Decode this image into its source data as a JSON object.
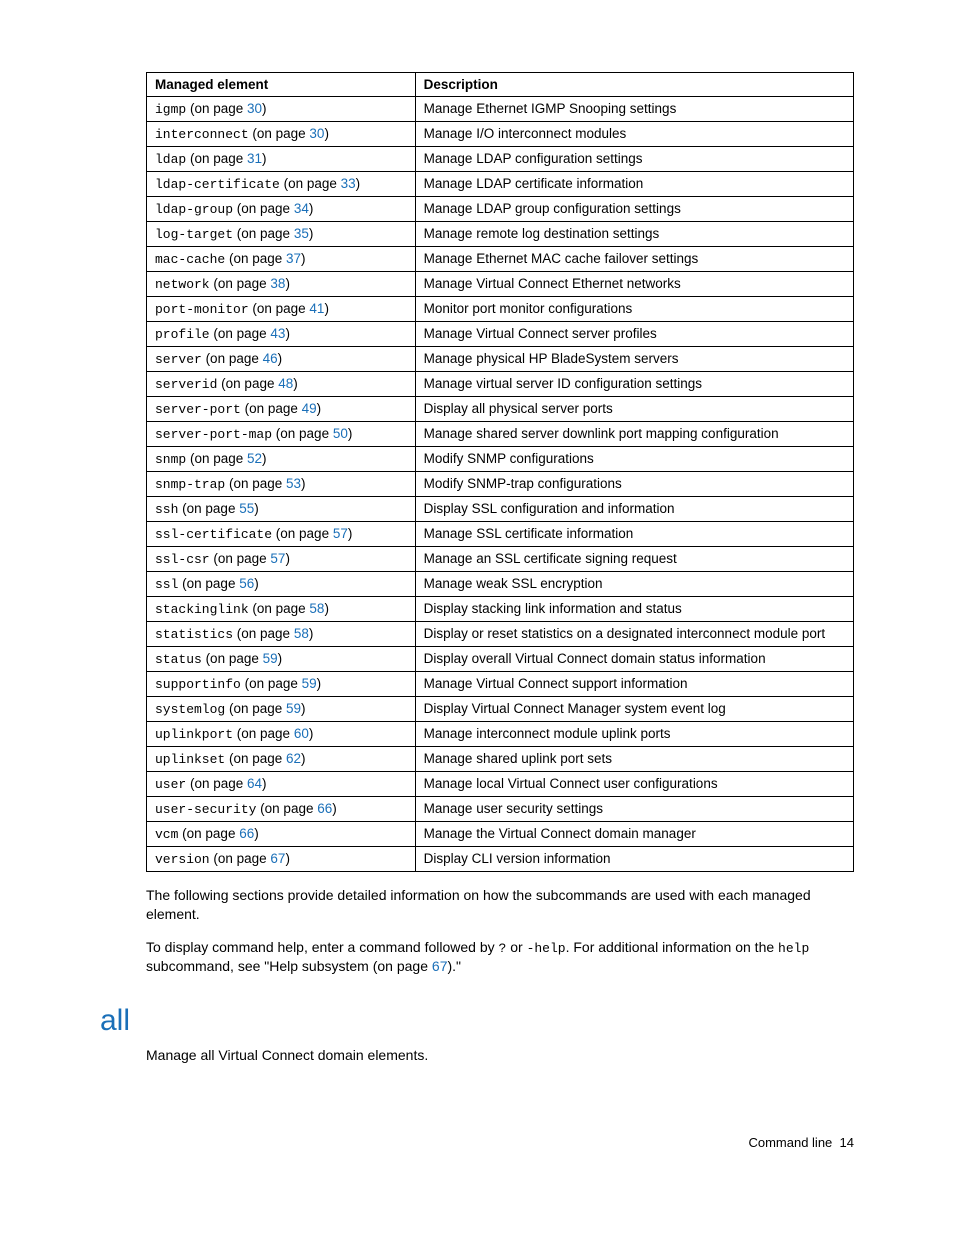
{
  "table": {
    "headers": {
      "element": "Managed element",
      "description": "Description"
    },
    "rows": [
      {
        "cmd": "igmp",
        "page": "30",
        "desc": "Manage Ethernet IGMP Snooping settings"
      },
      {
        "cmd": "interconnect",
        "page": "30",
        "desc": "Manage I/O interconnect modules"
      },
      {
        "cmd": "ldap",
        "page": "31",
        "desc": "Manage LDAP configuration settings"
      },
      {
        "cmd": "ldap-certificate",
        "page": "33",
        "desc": "Manage LDAP certificate information"
      },
      {
        "cmd": "ldap-group",
        "page": "34",
        "desc": "Manage LDAP group configuration settings"
      },
      {
        "cmd": "log-target",
        "page": "35",
        "desc": "Manage remote log destination settings"
      },
      {
        "cmd": "mac-cache",
        "page": "37",
        "desc": "Manage Ethernet MAC cache failover settings"
      },
      {
        "cmd": "network",
        "page": "38",
        "desc": "Manage Virtual Connect Ethernet networks"
      },
      {
        "cmd": "port-monitor",
        "page": "41",
        "desc": "Monitor port monitor configurations"
      },
      {
        "cmd": "profile",
        "page": "43",
        "desc": "Manage Virtual Connect server profiles"
      },
      {
        "cmd": "server",
        "page": "46",
        "desc": "Manage physical HP BladeSystem servers"
      },
      {
        "cmd": "serverid",
        "page": "48",
        "desc": "Manage virtual server ID configuration settings"
      },
      {
        "cmd": "server-port",
        "page": "49",
        "desc": "Display all physical server ports"
      },
      {
        "cmd": "server-port-map",
        "page": "50",
        "desc": "Manage shared server downlink port mapping configuration"
      },
      {
        "cmd": "snmp",
        "page": "52",
        "desc": "Modify SNMP configurations"
      },
      {
        "cmd": "snmp-trap",
        "page": "53",
        "desc": "Modify SNMP-trap configurations"
      },
      {
        "cmd": "ssh",
        "page": "55",
        "desc": "Display SSL configuration and information"
      },
      {
        "cmd": "ssl-certificate",
        "page": "57",
        "desc": "Manage SSL certificate information"
      },
      {
        "cmd": "ssl-csr",
        "page": "57",
        "desc": "Manage an SSL certificate signing request"
      },
      {
        "cmd": "ssl",
        "page": "56",
        "desc": "Manage weak SSL encryption"
      },
      {
        "cmd": "stackinglink",
        "page": "58",
        "desc": "Display stacking link information and status"
      },
      {
        "cmd": "statistics",
        "page": "58",
        "desc": "Display or reset statistics on a designated interconnect module port"
      },
      {
        "cmd": "status",
        "page": "59",
        "desc": "Display overall Virtual Connect domain status information"
      },
      {
        "cmd": "supportinfo",
        "page": "59",
        "desc": "Manage Virtual Connect support information"
      },
      {
        "cmd": "systemlog",
        "page": "59",
        "desc": "Display Virtual Connect Manager system event log"
      },
      {
        "cmd": "uplinkport",
        "page": "60",
        "desc": "Manage interconnect module uplink ports"
      },
      {
        "cmd": "uplinkset",
        "page": "62",
        "desc": "Manage shared uplink port sets"
      },
      {
        "cmd": "user",
        "page": "64",
        "desc": "Manage local Virtual Connect user configurations"
      },
      {
        "cmd": "user-security",
        "page": "66",
        "desc": "Manage user security settings"
      },
      {
        "cmd": "vcm",
        "page": "66",
        "desc": "Manage the Virtual Connect domain manager"
      },
      {
        "cmd": "version",
        "page": "67",
        "desc": "Display CLI version information"
      }
    ],
    "on_page_label": " (on page "
  },
  "paragraphs": {
    "p1": "The following sections provide detailed information on how the subcommands are used with each managed element.",
    "p2_a": "To display command help, enter a command followed by ",
    "p2_q": "?",
    "p2_or": " or ",
    "p2_helpflag": "-help",
    "p2_b": ". For additional information on the ",
    "p2_help": "help",
    "p2_c": " subcommand, see \"Help subsystem (on page ",
    "p2_page": "67",
    "p2_d": ").\""
  },
  "section": {
    "title": "all",
    "body": "Manage all Virtual Connect domain elements."
  },
  "footer": {
    "label": "Command line",
    "page": "14"
  }
}
